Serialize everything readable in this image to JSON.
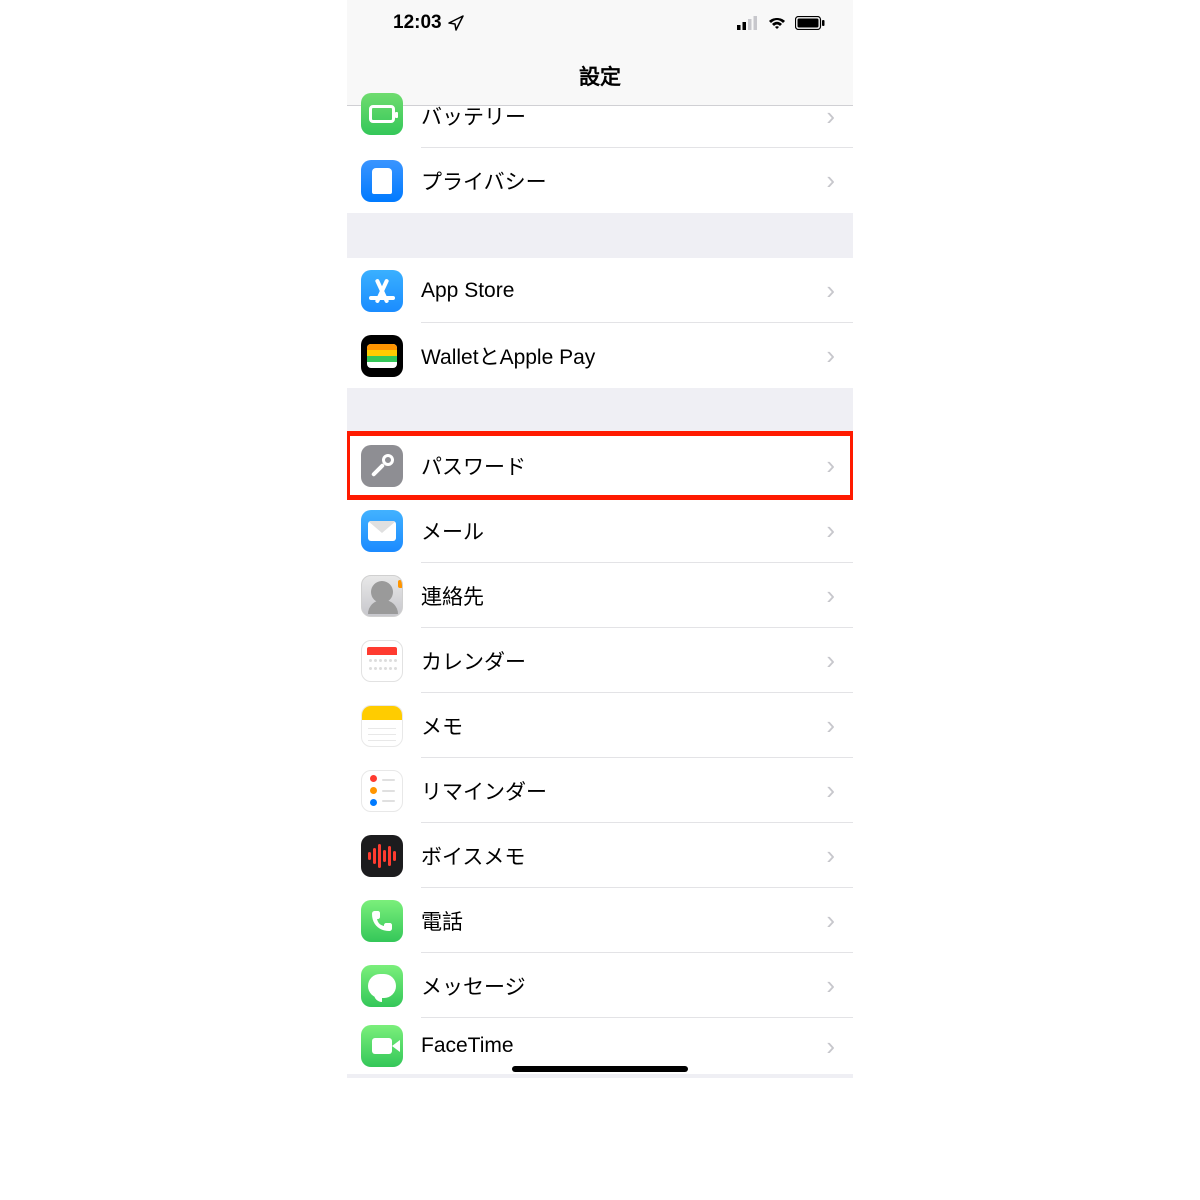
{
  "status": {
    "time": "12:03"
  },
  "nav": {
    "title": "設定"
  },
  "groups": [
    {
      "rows": [
        {
          "id": "battery",
          "label": "バッテリー",
          "iconClass": "bg-green",
          "iconName": "battery-icon"
        },
        {
          "id": "privacy",
          "label": "プライバシー",
          "iconClass": "bg-blue",
          "iconName": "hand-icon"
        }
      ]
    },
    {
      "rows": [
        {
          "id": "appstore",
          "label": "App Store",
          "iconClass": "bg-appstore",
          "iconName": "appstore-icon"
        },
        {
          "id": "wallet",
          "label": "WalletとApple Pay",
          "iconClass": "bg-wallet",
          "iconName": "wallet-icon"
        }
      ]
    },
    {
      "rows": [
        {
          "id": "passwords",
          "label": "パスワード",
          "iconClass": "bg-gray",
          "iconName": "key-icon",
          "highlighted": true
        },
        {
          "id": "mail",
          "label": "メール",
          "iconClass": "bg-mail",
          "iconName": "mail-icon"
        },
        {
          "id": "contacts",
          "label": "連絡先",
          "iconClass": "bg-contacts",
          "iconName": "contacts-icon"
        },
        {
          "id": "calendar",
          "label": "カレンダー",
          "iconClass": "bg-cal",
          "iconName": "calendar-icon"
        },
        {
          "id": "notes",
          "label": "メモ",
          "iconClass": "bg-notes",
          "iconName": "notes-icon"
        },
        {
          "id": "reminders",
          "label": "リマインダー",
          "iconClass": "bg-rem",
          "iconName": "reminders-icon"
        },
        {
          "id": "voicememos",
          "label": "ボイスメモ",
          "iconClass": "bg-voice",
          "iconName": "voicememo-icon"
        },
        {
          "id": "phone",
          "label": "電話",
          "iconClass": "bg-phone",
          "iconName": "phone-icon"
        },
        {
          "id": "messages",
          "label": "メッセージ",
          "iconClass": "bg-msg",
          "iconName": "messages-icon"
        },
        {
          "id": "facetime",
          "label": "FaceTime",
          "iconClass": "bg-ft",
          "iconName": "facetime-icon"
        }
      ]
    }
  ]
}
